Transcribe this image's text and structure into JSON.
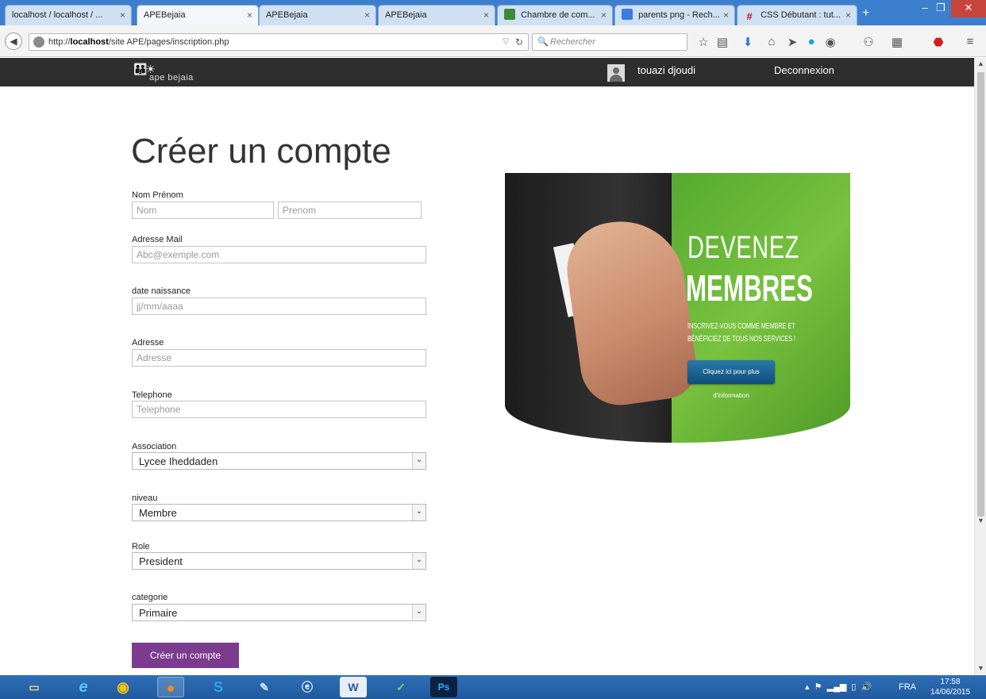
{
  "browser": {
    "tabs": [
      {
        "label": "localhost / localhost / ...",
        "active": false
      },
      {
        "label": "APEBejaia",
        "active": true
      },
      {
        "label": "APEBejaia",
        "active": false
      },
      {
        "label": "APEBejaia",
        "active": false
      },
      {
        "label": "Chambre de com...",
        "active": false
      },
      {
        "label": "parents png - Rech...",
        "active": false
      },
      {
        "label": "CSS Débutant : tut...",
        "active": false
      }
    ],
    "tab_close": "×",
    "new_tab": "+",
    "url_prefix": "http://",
    "url_host": "localhost",
    "url_path": "/site APE/pages/inscription.php",
    "search_placeholder": "Rechercher"
  },
  "header": {
    "logo_text": "ape bejaia",
    "username": "touazi djoudi",
    "logout": "Deconnexion"
  },
  "form": {
    "title": "Créer un compte",
    "nom_prenom_label": "Nom Prénom",
    "nom_placeholder": "Nom",
    "prenom_placeholder": "Prenom",
    "email_label": "Adresse Mail",
    "email_placeholder": "Abc@exemple.com",
    "birth_label": "date naissance",
    "birth_placeholder": "jj/mm/aaaa",
    "address_label": "Adresse",
    "address_placeholder": "Adresse",
    "phone_label": "Telephone",
    "phone_placeholder": "Telephone",
    "association_label": "Association",
    "association_value": "Lycee Iheddaden",
    "niveau_label": "niveau",
    "niveau_value": "Membre",
    "role_label": "Role",
    "role_value": "President",
    "categorie_label": "categorie",
    "categorie_value": "Primaire",
    "submit": "Créer un compte"
  },
  "promo": {
    "line1": "DEVENEZ",
    "line2": "MEMBRES",
    "subtitle": "INSCRIVEZ-VOUS COMME MEMBRE ET BÉNÉFICIEZ DE TOUS NOS SERVICES !",
    "cta": "Cliquez ici pour plus d'information"
  },
  "taskbar": {
    "lang": "FRA",
    "time": "17:58",
    "date": "14/06/2015"
  },
  "colors": {
    "header_bg": "#2e2e2e",
    "submit_bg": "#7b3b8f",
    "promo_green": "#5fb236"
  }
}
